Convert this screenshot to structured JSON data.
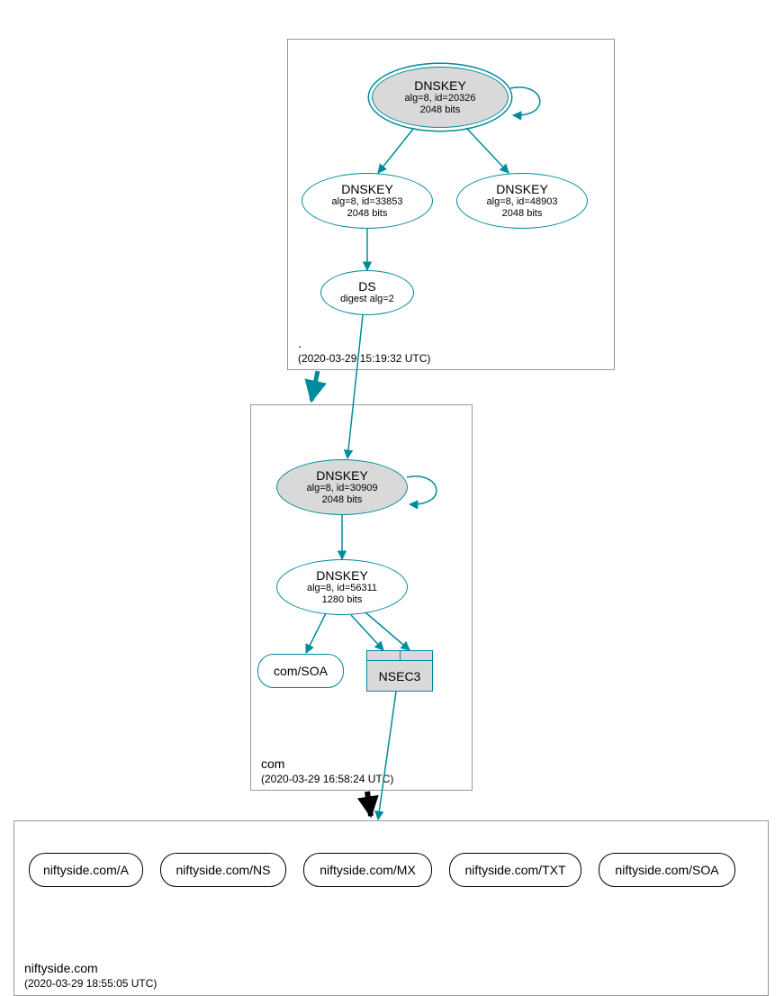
{
  "colors": {
    "teal": "#008b9c",
    "grey": "#d9d9d9"
  },
  "zones": {
    "root": {
      "label": ".",
      "timestamp": "(2020-03-29 15:19:32 UTC)"
    },
    "com": {
      "label": "com",
      "timestamp": "(2020-03-29 16:58:24 UTC)"
    },
    "niftyside": {
      "label": "niftyside.com",
      "timestamp": "(2020-03-29 18:55:05 UTC)"
    }
  },
  "nodes": {
    "root_ksk": {
      "title": "DNSKEY",
      "line1": "alg=8, id=20326",
      "line2": "2048 bits"
    },
    "root_zsk1": {
      "title": "DNSKEY",
      "line1": "alg=8, id=33853",
      "line2": "2048 bits"
    },
    "root_zsk2": {
      "title": "DNSKEY",
      "line1": "alg=8, id=48903",
      "line2": "2048 bits"
    },
    "root_ds": {
      "title": "DS",
      "line1": "digest alg=2"
    },
    "com_ksk": {
      "title": "DNSKEY",
      "line1": "alg=8, id=30909",
      "line2": "2048 bits"
    },
    "com_zsk": {
      "title": "DNSKEY",
      "line1": "alg=8, id=56311",
      "line2": "1280 bits"
    },
    "com_soa": {
      "label": "com/SOA"
    },
    "nsec3": {
      "label": "NSEC3"
    },
    "rr_a": {
      "label": "niftyside.com/A"
    },
    "rr_ns": {
      "label": "niftyside.com/NS"
    },
    "rr_mx": {
      "label": "niftyside.com/MX"
    },
    "rr_txt": {
      "label": "niftyside.com/TXT"
    },
    "rr_soa": {
      "label": "niftyside.com/SOA"
    }
  }
}
